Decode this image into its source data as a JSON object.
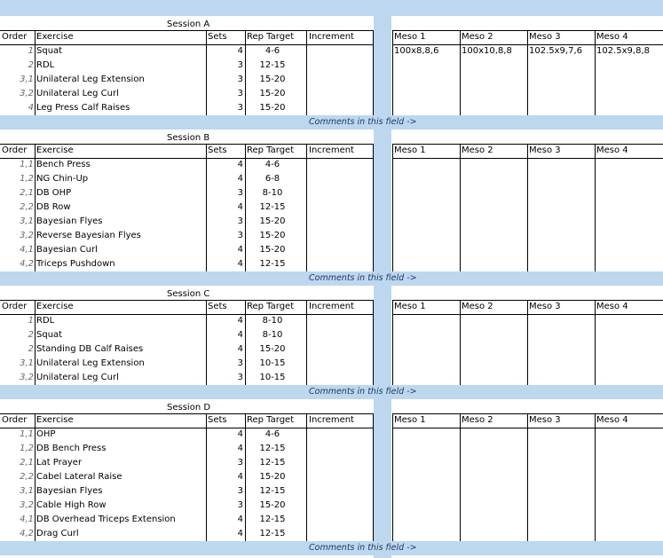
{
  "columns": {
    "order": "Order",
    "exercise": "Exercise",
    "sets": "Sets",
    "rep_target": "Rep Target",
    "increment": "Increment"
  },
  "comment_text": "Comments in this field ->",
  "colors": {
    "band": "#bdd7ee",
    "order_text": "#666666"
  },
  "sessions": [
    {
      "title": "Session A",
      "meso_headers": [
        "Meso 1",
        "Meso 2",
        "Meso 3",
        "Meso 4"
      ],
      "meso_values": [
        "100x8,8,6",
        "100x10,8,8",
        "102.5x9,7,6",
        "102.5x9,8,8"
      ],
      "rows": [
        {
          "order": "1",
          "exercise": "Squat",
          "sets": "4",
          "rep": "4-6"
        },
        {
          "order": "2",
          "exercise": "RDL",
          "sets": "3",
          "rep": "12-15"
        },
        {
          "order": "3,1",
          "exercise": "Unilateral Leg Extension",
          "sets": "3",
          "rep": "15-20"
        },
        {
          "order": "3,2",
          "exercise": "Unilateral Leg Curl",
          "sets": "3",
          "rep": "15-20"
        },
        {
          "order": "4",
          "exercise": "Leg Press Calf Raises",
          "sets": "3",
          "rep": "15-20"
        }
      ]
    },
    {
      "title": "Session B",
      "meso_headers": [
        "Meso 1",
        "Meso 2",
        "Meso 3",
        "Meso 4"
      ],
      "meso_values": [
        "",
        "",
        "",
        ""
      ],
      "rows": [
        {
          "order": "1,1",
          "exercise": "Bench Press",
          "sets": "4",
          "rep": "4-6"
        },
        {
          "order": "1,2",
          "exercise": "NG Chin-Up",
          "sets": "4",
          "rep": "6-8"
        },
        {
          "order": "2,1",
          "exercise": "DB OHP",
          "sets": "3",
          "rep": "8-10"
        },
        {
          "order": "2,2",
          "exercise": "DB Row",
          "sets": "4",
          "rep": "12-15"
        },
        {
          "order": "3,1",
          "exercise": "Bayesian Flyes",
          "sets": "3",
          "rep": "15-20"
        },
        {
          "order": "3,2",
          "exercise": "Reverse Bayesian Flyes",
          "sets": "3",
          "rep": "15-20"
        },
        {
          "order": "4,1",
          "exercise": "Bayesian Curl",
          "sets": "4",
          "rep": "15-20"
        },
        {
          "order": "4,2",
          "exercise": "Triceps Pushdown",
          "sets": "4",
          "rep": "12-15"
        }
      ]
    },
    {
      "title": "Session C",
      "meso_headers": [
        "Meso 1",
        "Meso 2",
        "Meso 3",
        "Meso 4"
      ],
      "meso_values": [
        "",
        "",
        "",
        ""
      ],
      "rows": [
        {
          "order": "1",
          "exercise": "RDL",
          "sets": "4",
          "rep": "8-10"
        },
        {
          "order": "2",
          "exercise": "Squat",
          "sets": "4",
          "rep": "8-10"
        },
        {
          "order": "2",
          "exercise": "Standing DB Calf Raises",
          "sets": "4",
          "rep": "15-20"
        },
        {
          "order": "3,1",
          "exercise": "Unilateral Leg Extension",
          "sets": "3",
          "rep": "10-15"
        },
        {
          "order": "3,2",
          "exercise": "Unilateral Leg Curl",
          "sets": "3",
          "rep": "10-15"
        }
      ]
    },
    {
      "title": "Session D",
      "meso_headers": [
        "Meso 1",
        "Meso 2",
        "Meso 3",
        "Meso 4"
      ],
      "meso_values": [
        "",
        "",
        "",
        ""
      ],
      "rows": [
        {
          "order": "1,1",
          "exercise": "OHP",
          "sets": "4",
          "rep": "4-6"
        },
        {
          "order": "1,2",
          "exercise": "DB Bench Press",
          "sets": "4",
          "rep": "12-15"
        },
        {
          "order": "2,1",
          "exercise": "Lat Prayer",
          "sets": "3",
          "rep": "12-15"
        },
        {
          "order": "2,2",
          "exercise": "Cabel Lateral Raise",
          "sets": "4",
          "rep": "15-20"
        },
        {
          "order": "3,1",
          "exercise": "Bayesian Flyes",
          "sets": "3",
          "rep": "12-15"
        },
        {
          "order": "3,2",
          "exercise": "Cable High Row",
          "sets": "3",
          "rep": "15-20"
        },
        {
          "order": "4,1",
          "exercise": "DB Overhead Triceps Extension",
          "sets": "4",
          "rep": "12-15"
        },
        {
          "order": "4,2",
          "exercise": "Drag Curl",
          "sets": "4",
          "rep": "12-15"
        }
      ]
    }
  ]
}
